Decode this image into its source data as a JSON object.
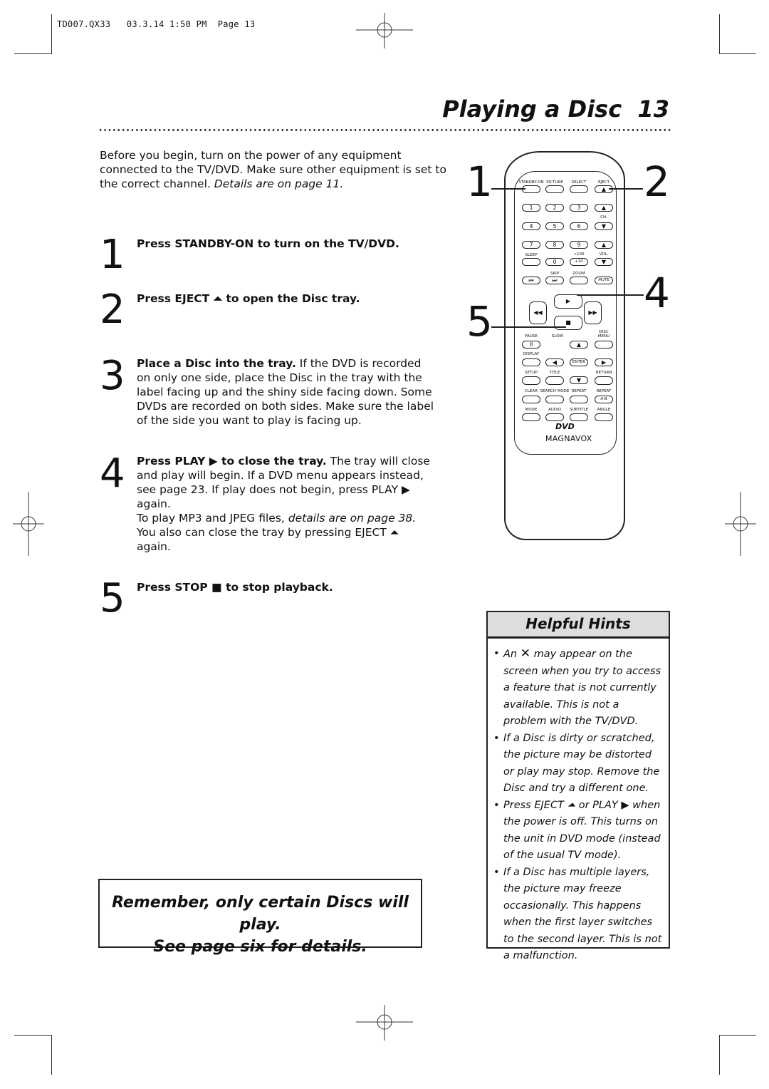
{
  "slug": "TD007.QX33   03.3.14 1:50 PM  Page 13",
  "header": {
    "title": "Playing a Disc",
    "page_number": "13"
  },
  "intro": {
    "text": "Before you begin, turn on the power of any equipment connected to the TV/DVD.  Make sure other equipment is set to the correct channel. ",
    "italic": "Details are on page 11."
  },
  "steps": [
    {
      "number": "1",
      "bold": "Press STANDBY-ON to turn on the TV/DVD.",
      "text": ""
    },
    {
      "number": "2",
      "bold": "Press EJECT ⏶ to open the Disc tray.",
      "text": ""
    },
    {
      "number": "3",
      "bold": "Place a Disc into the tray.",
      "text": " If the DVD is recorded on only one side, place the Disc in the tray with the label facing up and the shiny side facing down. Some DVDs are recorded on both sides.  Make sure the label of the side you want to play is facing up."
    },
    {
      "number": "4",
      "bold": "Press PLAY ▶ to close the tray.",
      "text": " The tray will close and play will begin.  If a DVD menu appears instead, see page 23.  If play does not begin, press PLAY ▶ again.",
      "text2": "To play MP3 and JPEG files, ",
      "italic2": "details are on page 38.",
      "text3": "You also can close the tray by pressing EJECT ⏶ again."
    },
    {
      "number": "5",
      "bold": "Press STOP ■ to stop playback.",
      "text": ""
    }
  ],
  "remember": {
    "line1": "Remember, only certain Discs will play.",
    "line2": "See page six for details."
  },
  "hints": {
    "title": "Helpful Hints",
    "items": [
      {
        "pre": "An",
        "icon": "x-mark-icon",
        "post": "may appear on the screen when you try to access a feature that is not currently available. This is not a problem with the TV/DVD."
      },
      {
        "text": "If a Disc is dirty or scratched, the picture may be distorted or play may stop.  Remove the Disc and try a different one."
      },
      {
        "text": "Press EJECT ⏶ or PLAY ▶ when the power is off. This turns on the unit in DVD mode (instead of the usual TV mode)."
      },
      {
        "text": "If a Disc has multiple layers, the picture may freeze occasionally. This happens when the first layer switches to the second layer. This is not a malfunction."
      }
    ]
  },
  "remote": {
    "callouts": [
      "1",
      "2",
      "4",
      "5"
    ],
    "labels": [
      "STANDBY-ON",
      "PICTURE",
      "SELECT",
      "EJECT",
      "CH.",
      "SLEEP",
      "+100",
      "VOL.",
      "SKIP",
      "ZOOM",
      "PLAY",
      "STOP",
      "SLOW",
      "PAUSE",
      "DISC MENU",
      "DISPLAY",
      "SETUP",
      "TITLE",
      "RETURN",
      "CLEAR",
      "SEARCH MODE",
      "REPEAT",
      "REPEAT",
      "MODE",
      "AUDIO",
      "SUBTITLE",
      "ANGLE"
    ],
    "buttons": [
      "",
      "",
      "",
      "▲",
      "1",
      "2",
      "3",
      "▲",
      "4",
      "5",
      "6",
      "▼",
      "7",
      "8",
      "9",
      "▲",
      "",
      "0",
      "+10",
      "▼",
      "⏮",
      "⏭",
      "",
      "MUTE",
      "▶",
      "◀◀",
      "▶▶",
      "■",
      "II",
      "▲",
      "",
      "",
      "◀",
      "ENTER",
      "▶",
      "",
      "",
      "▼",
      "",
      "",
      "",
      "",
      "A-B",
      "",
      "",
      "",
      ""
    ],
    "dvd_logo": "DVD",
    "brand": "MAGNAVOX"
  }
}
